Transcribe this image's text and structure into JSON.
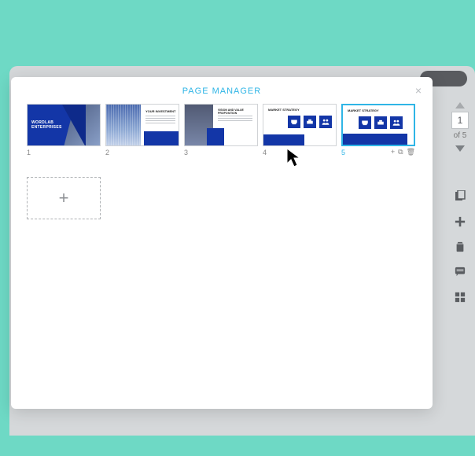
{
  "modal": {
    "title": "PAGE MANAGER",
    "add_label": "+"
  },
  "slides": [
    {
      "num": "1",
      "title_a": "WORDLAB",
      "title_b": "ENTERPRISES"
    },
    {
      "num": "2",
      "title": "YOUR INVESTMENT"
    },
    {
      "num": "3",
      "title_a": "VISION AND VALUE",
      "title_b": "PROPOSITION"
    },
    {
      "num": "4",
      "title": "MARKET STRATEGY"
    },
    {
      "num": "5",
      "title": "MARKET STRATEGY"
    }
  ],
  "thumb_actions": {
    "add": "+",
    "copy": "⧉",
    "delete": "🗑"
  },
  "nav": {
    "current": "1",
    "of_label": "of 5"
  }
}
